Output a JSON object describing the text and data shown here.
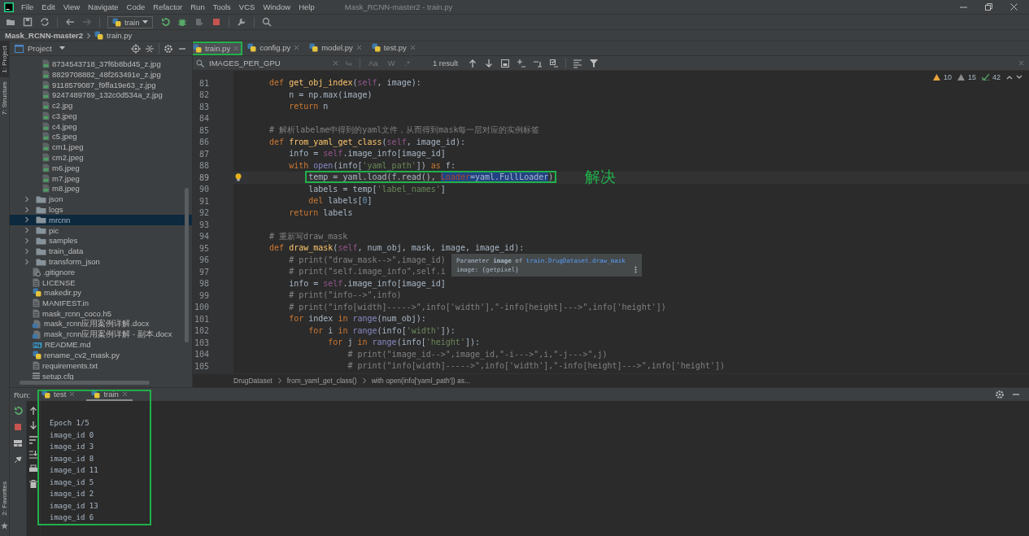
{
  "menu": {
    "items": [
      "File",
      "Edit",
      "View",
      "Navigate",
      "Code",
      "Refactor",
      "Run",
      "Tools",
      "VCS",
      "Window",
      "Help"
    ],
    "title": "Mask_RCNN-master2 - train.py"
  },
  "toolbar": {
    "run_config": "train"
  },
  "navbar": {
    "project": "Mask_RCNN-master2",
    "file": "train.py"
  },
  "side_stripe": {
    "top": [
      {
        "label": "1: Project",
        "selected": true
      },
      {
        "label": "7: Structure",
        "selected": false
      }
    ],
    "bottom": "2: Favorites"
  },
  "project": {
    "title": "Project",
    "nested_files": [
      {
        "name": "8734543718_37f6b8bd45_z.jpg",
        "kind": "image",
        "selected": false
      },
      {
        "name": "8829708882_48f263491e_z.jpg",
        "kind": "image",
        "selected": false
      },
      {
        "name": "9118579087_f9ffa19e63_z.jpg",
        "kind": "image",
        "selected": false
      },
      {
        "name": "9247489789_132c0d534a_z.jpg",
        "kind": "image",
        "selected": false
      },
      {
        "name": "c2.jpg",
        "kind": "image",
        "selected": false
      },
      {
        "name": "c3.jpeg",
        "kind": "image",
        "selected": false
      },
      {
        "name": "c4.jpeg",
        "kind": "image",
        "selected": false
      },
      {
        "name": "c5.jpeg",
        "kind": "image",
        "selected": false
      },
      {
        "name": "cm1.jpeg",
        "kind": "image",
        "selected": false
      },
      {
        "name": "cm2.jpeg",
        "kind": "image",
        "selected": false
      },
      {
        "name": "m6.jpeg",
        "kind": "image",
        "selected": false
      },
      {
        "name": "m7.jpeg",
        "kind": "image",
        "selected": false
      },
      {
        "name": "m8.jpeg",
        "kind": "image",
        "selected": false
      }
    ],
    "items": [
      {
        "name": "json",
        "kind": "folder",
        "expanded": false,
        "selected": false
      },
      {
        "name": "logs",
        "kind": "folder",
        "expanded": false,
        "selected": false
      },
      {
        "name": "mrcnn",
        "kind": "folder",
        "expanded": false,
        "selected": true
      },
      {
        "name": "pic",
        "kind": "folder",
        "expanded": false,
        "selected": false
      },
      {
        "name": "samples",
        "kind": "folder",
        "expanded": false,
        "selected": false
      },
      {
        "name": "train_data",
        "kind": "folder",
        "expanded": false,
        "selected": false
      },
      {
        "name": "transform_json",
        "kind": "folder",
        "expanded": false,
        "selected": false
      },
      {
        "name": ".gitignore",
        "kind": "ignore",
        "selected": false
      },
      {
        "name": "LICENSE",
        "kind": "text",
        "selected": false
      },
      {
        "name": "makedir.py",
        "kind": "python",
        "selected": false
      },
      {
        "name": "MANIFEST.in",
        "kind": "text",
        "selected": false
      },
      {
        "name": "mask_rcnn_coco.h5",
        "kind": "text",
        "selected": false
      },
      {
        "name": "mask_rcnn应用案例详解.docx",
        "kind": "doc",
        "selected": false
      },
      {
        "name": "mask_rcnn应用案例详解 - 副本.docx",
        "kind": "doc",
        "selected": false
      },
      {
        "name": "README.md",
        "kind": "markdown",
        "selected": false
      },
      {
        "name": "rename_cv2_mask.py",
        "kind": "python",
        "selected": false
      },
      {
        "name": "requirements.txt",
        "kind": "text",
        "selected": false
      },
      {
        "name": "setup.cfg",
        "kind": "config",
        "selected": false
      }
    ]
  },
  "editor": {
    "tabs": [
      {
        "name": "train.py",
        "selected": true,
        "boxed": true
      },
      {
        "name": "config.py",
        "selected": false,
        "boxed": false
      },
      {
        "name": "model.py",
        "selected": false,
        "boxed": false
      },
      {
        "name": "test.py",
        "selected": false,
        "boxed": false
      }
    ],
    "search": {
      "value": "IMAGES_PER_GPU",
      "toggles": [
        "Aa",
        "W",
        ".*"
      ],
      "result": "1 result"
    },
    "inspections": {
      "errors": "10",
      "warnings": "15",
      "typos": "42"
    },
    "lines": [
      {
        "number": "81",
        "current": false,
        "segments": [
          {
            "kind": "kw",
            "text": "    def "
          },
          {
            "kind": "fn",
            "text": "get_obj_index"
          },
          {
            "kind": "p",
            "text": "("
          },
          {
            "kind": "self",
            "text": "self"
          },
          {
            "kind": "p",
            "text": ", image):"
          }
        ]
      },
      {
        "number": "82",
        "current": false,
        "segments": [
          {
            "kind": "p",
            "text": "        n = np.max(image)"
          }
        ]
      },
      {
        "number": "83",
        "current": false,
        "segments": [
          {
            "kind": "kw",
            "text": "        return"
          },
          {
            "kind": "p",
            "text": " n"
          }
        ]
      },
      {
        "number": "84",
        "current": false
      },
      {
        "number": "85",
        "current": false,
        "segments": [
          {
            "kind": "cm",
            "text": "    # 解析labelme中得到的yaml文件，从而得到mask每一层对应的实例标签"
          }
        ]
      },
      {
        "number": "86",
        "current": false,
        "segments": [
          {
            "kind": "kw",
            "text": "    def "
          },
          {
            "kind": "fn",
            "text": "from_yaml_get_class"
          },
          {
            "kind": "p",
            "text": "("
          },
          {
            "kind": "self",
            "text": "self"
          },
          {
            "kind": "p",
            "text": ", image_id):"
          }
        ]
      },
      {
        "number": "87",
        "current": false,
        "segments": [
          {
            "kind": "p",
            "text": "        info = "
          },
          {
            "kind": "self",
            "text": "self"
          },
          {
            "kind": "p",
            "text": ".image_info[image_id]"
          }
        ]
      },
      {
        "number": "88",
        "current": false,
        "segments": [
          {
            "kind": "kw",
            "text": "        with "
          },
          {
            "kind": "bi",
            "text": "open"
          },
          {
            "kind": "p",
            "text": "(info["
          },
          {
            "kind": "str",
            "text": "'yaml_path'"
          },
          {
            "kind": "p",
            "text": "]) "
          },
          {
            "kind": "kw",
            "text": "as"
          },
          {
            "kind": "p",
            "text": " f:"
          }
        ]
      },
      {
        "number": "89",
        "current": true,
        "boxed": true,
        "bulb": true,
        "note": "解决",
        "segments": [
          {
            "kind": "p",
            "text": "temp = yaml.load(f.read(), "
          },
          {
            "kind": "argsel",
            "text": "Loader"
          },
          {
            "kind": "sel",
            "text": "=yaml.FullLoader"
          },
          {
            "kind": "p",
            "text": ")"
          }
        ]
      },
      {
        "number": "90",
        "current": false,
        "segments": [
          {
            "kind": "p",
            "text": "            labels = temp["
          },
          {
            "kind": "str",
            "text": "'label_names'"
          },
          {
            "kind": "p",
            "text": "]"
          }
        ]
      },
      {
        "number": "91",
        "current": false,
        "segments": [
          {
            "kind": "kw",
            "text": "            del"
          },
          {
            "kind": "p",
            "text": " labels["
          },
          {
            "kind": "num",
            "text": "0"
          },
          {
            "kind": "p",
            "text": "]"
          }
        ]
      },
      {
        "number": "92",
        "current": false,
        "segments": [
          {
            "kind": "kw",
            "text": "        return"
          },
          {
            "kind": "p",
            "text": " labels"
          }
        ]
      },
      {
        "number": "93",
        "current": false
      },
      {
        "number": "94",
        "current": false,
        "segments": [
          {
            "kind": "cm",
            "text": "    # 重新写draw_mask"
          }
        ]
      },
      {
        "number": "95",
        "current": false,
        "segments": [
          {
            "kind": "kw",
            "text": "    def "
          },
          {
            "kind": "fn",
            "text": "draw_mask"
          },
          {
            "kind": "p",
            "text": "("
          },
          {
            "kind": "self",
            "text": "self"
          },
          {
            "kind": "p",
            "text": ", num_obj, mask, image, image_id):"
          }
        ]
      },
      {
        "number": "96",
        "current": false,
        "segments": [
          {
            "kind": "cm",
            "text": "        # print(\"draw_mask-->\",image_id)"
          }
        ]
      },
      {
        "number": "97",
        "current": false,
        "segments": [
          {
            "kind": "cm",
            "text": "        # print(\"self.image_info\",self.i"
          }
        ]
      },
      {
        "number": "98",
        "current": false,
        "segments": [
          {
            "kind": "p",
            "text": "        info = "
          },
          {
            "kind": "self",
            "text": "self"
          },
          {
            "kind": "p",
            "text": ".image_info[image_id]"
          }
        ]
      },
      {
        "number": "99",
        "current": false,
        "segments": [
          {
            "kind": "cm",
            "text": "        # print(\"info-->\",info)"
          }
        ]
      },
      {
        "number": "100",
        "current": false,
        "segments": [
          {
            "kind": "cm",
            "text": "        # print(\"info[width]----->\",info['width'],\"-info[height]--->\",info['height'])"
          }
        ]
      },
      {
        "number": "101",
        "current": false,
        "segments": [
          {
            "kind": "kw",
            "text": "        for"
          },
          {
            "kind": "p",
            "text": " index "
          },
          {
            "kind": "kw",
            "text": "in "
          },
          {
            "kind": "bi",
            "text": "range"
          },
          {
            "kind": "p",
            "text": "(num_obj):"
          }
        ]
      },
      {
        "number": "102",
        "current": false,
        "segments": [
          {
            "kind": "kw",
            "text": "            for"
          },
          {
            "kind": "p",
            "text": " i "
          },
          {
            "kind": "kw",
            "text": "in "
          },
          {
            "kind": "bi",
            "text": "range"
          },
          {
            "kind": "p",
            "text": "(info["
          },
          {
            "kind": "str",
            "text": "'width'"
          },
          {
            "kind": "p",
            "text": "]):"
          }
        ]
      },
      {
        "number": "103",
        "current": false,
        "segments": [
          {
            "kind": "kw",
            "text": "                for"
          },
          {
            "kind": "p",
            "text": " j "
          },
          {
            "kind": "kw",
            "text": "in "
          },
          {
            "kind": "bi",
            "text": "range"
          },
          {
            "kind": "p",
            "text": "(info["
          },
          {
            "kind": "str",
            "text": "'height'"
          },
          {
            "kind": "p",
            "text": "]):"
          }
        ]
      },
      {
        "number": "104",
        "current": false,
        "segments": [
          {
            "kind": "cm",
            "text": "                    # print(\"image_id-->\",image_id,\"-i--->\",i,\"-j--->\",j)"
          }
        ]
      },
      {
        "number": "105",
        "current": false,
        "segments": [
          {
            "kind": "cm",
            "text": "                    # print(\"info[width]----->\",info['width'],\"-info[height]--->\",info['height'])"
          }
        ]
      }
    ],
    "tooltip": {
      "text": "Parameter **image** of",
      "link": "train.DrugDataset.draw_mask",
      "detail": "image: {getpixel}"
    },
    "breadcrumbs": [
      "DrugDataset",
      "from_yaml_get_class()",
      "with open(info['yaml_path']) as..."
    ]
  },
  "run": {
    "label": "Run:",
    "boxed": true,
    "tabs": [
      {
        "name": "test",
        "selected": false
      },
      {
        "name": "train",
        "selected": true
      }
    ],
    "output": [
      "Epoch 1/5",
      "image_id 0",
      "image_id 3",
      "image_id 8",
      "image_id 11",
      "image_id 5",
      "image_id 2",
      "image_id 13",
      "image_id 6"
    ]
  }
}
